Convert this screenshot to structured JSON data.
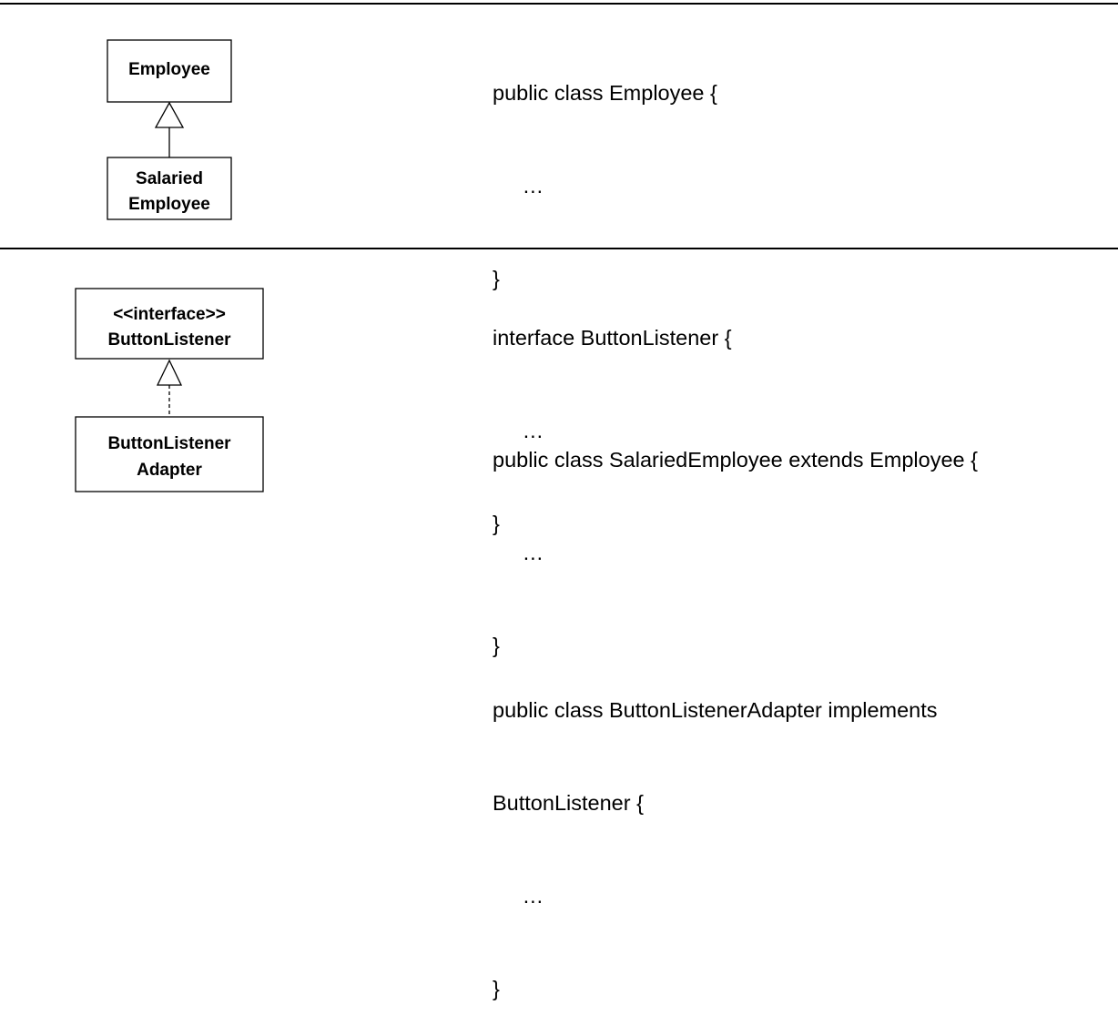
{
  "rows": [
    {
      "parent": {
        "lines": [
          "Employee"
        ]
      },
      "child": {
        "lines": [
          "Salaried",
          "Employee"
        ]
      },
      "relation": "generalization",
      "code": [
        "public class Employee {",
        "     …",
        "}",
        "",
        "public class SalariedEmployee extends Employee {",
        "     …",
        "}"
      ]
    },
    {
      "parent": {
        "lines": [
          "<<interface>>",
          "ButtonListener"
        ]
      },
      "child": {
        "lines": [
          "ButtonListener",
          "Adapter"
        ]
      },
      "relation": "realization",
      "code": [
        "interface ButtonListener {",
        "     …",
        "}",
        "",
        "public class ButtonListenerAdapter implements",
        "ButtonListener {",
        "     …",
        "}"
      ]
    }
  ]
}
